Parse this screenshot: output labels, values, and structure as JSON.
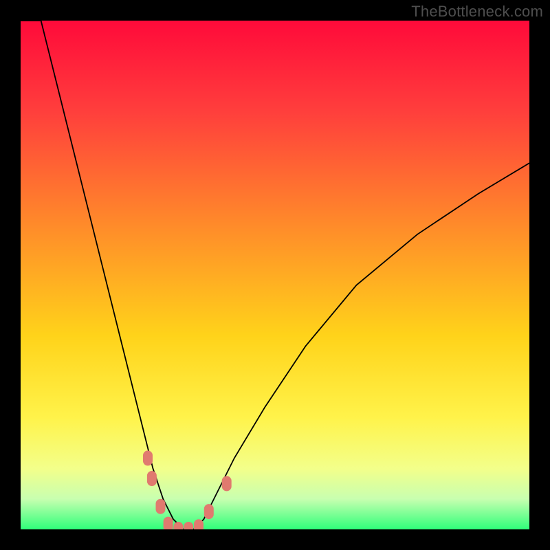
{
  "watermark": "TheBottleneck.com",
  "colors": {
    "gradient": [
      {
        "offset": "0%",
        "hex": "#ff0a3a"
      },
      {
        "offset": "18%",
        "hex": "#ff3f3c"
      },
      {
        "offset": "40%",
        "hex": "#ff8a2a"
      },
      {
        "offset": "62%",
        "hex": "#ffd31a"
      },
      {
        "offset": "78%",
        "hex": "#fff34a"
      },
      {
        "offset": "88%",
        "hex": "#f3ff8a"
      },
      {
        "offset": "94%",
        "hex": "#c8ffb0"
      },
      {
        "offset": "100%",
        "hex": "#2fff7a"
      }
    ],
    "curve": "#000000",
    "marker": "#e07a6f",
    "frame": "#000000"
  },
  "chart_data": {
    "type": "line",
    "title": "",
    "xlabel": "",
    "ylabel": "",
    "xlim": [
      0,
      100
    ],
    "ylim": [
      0,
      100
    ],
    "curve": {
      "name": "bottleneck",
      "x": [
        0,
        4,
        8,
        12,
        16,
        20,
        24,
        26,
        28,
        30,
        32,
        34,
        36,
        38,
        42,
        48,
        56,
        66,
        78,
        90,
        100
      ],
      "percent": [
        120,
        100,
        84,
        68,
        52,
        36,
        20,
        12,
        6,
        2,
        0,
        0,
        2,
        6,
        14,
        24,
        36,
        48,
        58,
        66,
        72
      ]
    },
    "markers": [
      {
        "x": 25.0,
        "percent": 14.0
      },
      {
        "x": 25.8,
        "percent": 10.0
      },
      {
        "x": 27.5,
        "percent": 4.5
      },
      {
        "x": 29.0,
        "percent": 1.0
      },
      {
        "x": 31.0,
        "percent": 0.0
      },
      {
        "x": 33.0,
        "percent": 0.0
      },
      {
        "x": 35.0,
        "percent": 0.5
      },
      {
        "x": 37.0,
        "percent": 3.5
      },
      {
        "x": 40.5,
        "percent": 9.0
      }
    ],
    "annotations": []
  }
}
